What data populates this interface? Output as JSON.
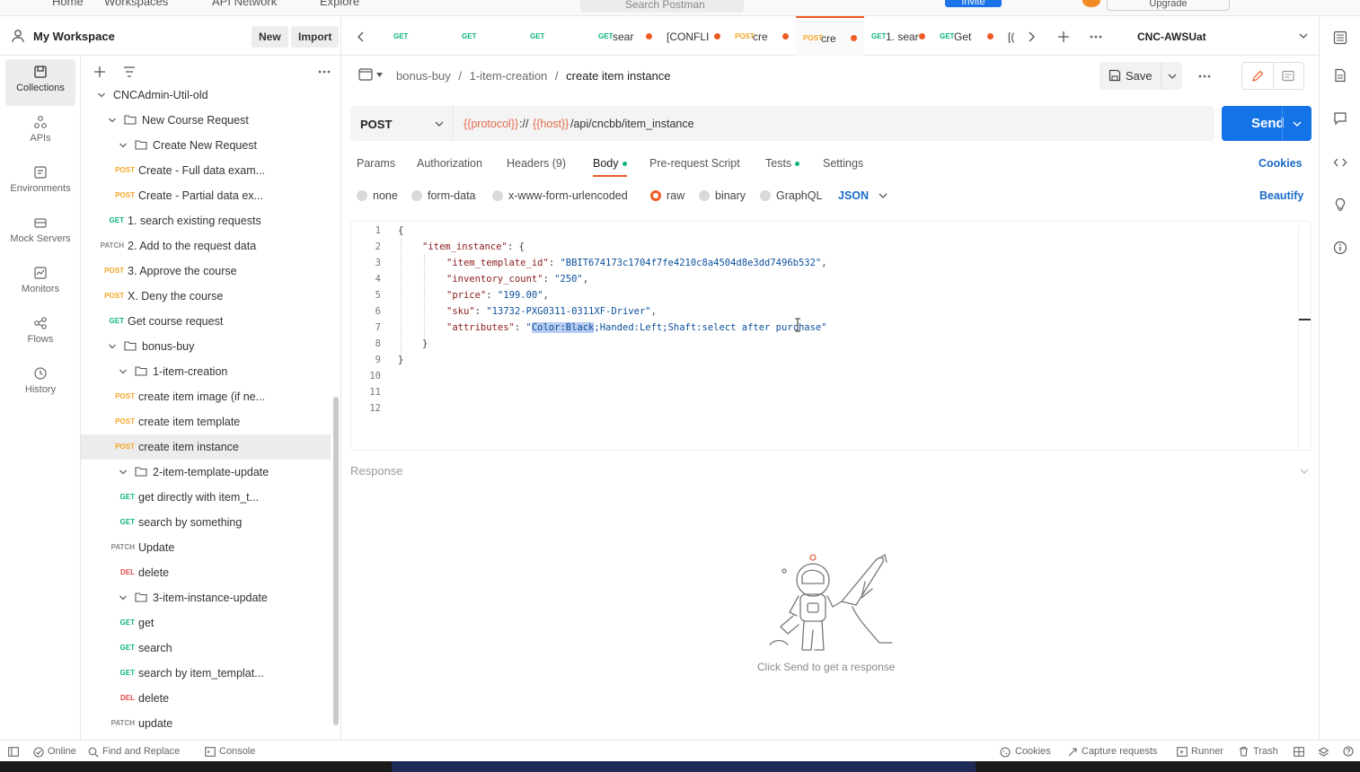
{
  "topbar": {
    "home": "Home",
    "workspaces": "Workspaces",
    "api_network": "API Network",
    "explore": "Explore",
    "search_placeholder": "Search Postman",
    "invite": "Invite",
    "upgrade": "Upgrade"
  },
  "workspace": {
    "title": "My Workspace",
    "new_label": "New",
    "import_label": "Import"
  },
  "rail": [
    {
      "label": "Collections",
      "icon": "collections-icon"
    },
    {
      "label": "APIs",
      "icon": "apis-icon"
    },
    {
      "label": "Environments",
      "icon": "environments-icon"
    },
    {
      "label": "Mock Servers",
      "icon": "mock-servers-icon"
    },
    {
      "label": "Monitors",
      "icon": "monitors-icon"
    },
    {
      "label": "Flows",
      "icon": "flows-icon"
    },
    {
      "label": "History",
      "icon": "history-icon"
    }
  ],
  "tree": [
    {
      "kind": "collection",
      "label": "CNCAdmin-Util-old",
      "method": ""
    },
    {
      "kind": "folder",
      "label": "New Course Request",
      "method": ""
    },
    {
      "kind": "folder",
      "label": "Create New Request",
      "method": ""
    },
    {
      "kind": "request",
      "label": "Create - Full data exam...",
      "method": "POST"
    },
    {
      "kind": "request",
      "label": "Create - Partial data ex...",
      "method": "POST"
    },
    {
      "kind": "request",
      "label": "1. search existing requests",
      "method": "GET"
    },
    {
      "kind": "request",
      "label": "2. Add to the request data",
      "method": "PATCH"
    },
    {
      "kind": "request",
      "label": "3. Approve the course",
      "method": "POST"
    },
    {
      "kind": "request",
      "label": "X. Deny the course",
      "method": "POST"
    },
    {
      "kind": "request",
      "label": "Get course request",
      "method": "GET"
    },
    {
      "kind": "folder",
      "label": "bonus-buy",
      "method": ""
    },
    {
      "kind": "folder",
      "label": "1-item-creation",
      "method": ""
    },
    {
      "kind": "request",
      "label": "create item image (if ne...",
      "method": "POST"
    },
    {
      "kind": "request",
      "label": "create item template",
      "method": "POST"
    },
    {
      "kind": "request",
      "label": "create item instance",
      "method": "POST"
    },
    {
      "kind": "folder",
      "label": "2-item-template-update",
      "method": ""
    },
    {
      "kind": "request",
      "label": "get directly with item_t...",
      "method": "GET"
    },
    {
      "kind": "request",
      "label": "search by something",
      "method": "GET"
    },
    {
      "kind": "request",
      "label": "Update",
      "method": "PATCH"
    },
    {
      "kind": "request",
      "label": "delete",
      "method": "DEL"
    },
    {
      "kind": "folder",
      "label": "3-item-instance-update",
      "method": ""
    },
    {
      "kind": "request",
      "label": "get",
      "method": "GET"
    },
    {
      "kind": "request",
      "label": "search",
      "method": "GET"
    },
    {
      "kind": "request",
      "label": "search by item_templat...",
      "method": "GET"
    },
    {
      "kind": "request",
      "label": "delete",
      "method": "DEL"
    },
    {
      "kind": "request",
      "label": "update",
      "method": "PATCH"
    }
  ],
  "tabs": [
    {
      "method": "GET",
      "title": ""
    },
    {
      "method": "GET",
      "title": ""
    },
    {
      "method": "GET",
      "title": ""
    },
    {
      "method": "GET",
      "title": "sear"
    },
    {
      "method": "",
      "title": "[CONFLI"
    },
    {
      "method": "POST",
      "title": "cre"
    },
    {
      "method": "POST",
      "title": "cre"
    },
    {
      "method": "GET",
      "title": "1. sear"
    },
    {
      "method": "GET",
      "title": "Get"
    },
    {
      "method": "",
      "title": "[("
    }
  ],
  "environment": "CNC-AWSUat",
  "breadcrumb": {
    "collection": "bonus-buy",
    "folder": "1-item-creation",
    "request": "create item instance",
    "sep": "/"
  },
  "save_label": "Save",
  "request": {
    "method": "POST",
    "url_var1": "{{protocol}}",
    "url_mid": "://",
    "url_var2": "{{host}}",
    "url_path": "/api/cncbb/item_instance",
    "send_label": "Send"
  },
  "subtabs": {
    "params": "Params",
    "authorization": "Authorization",
    "headers": "Headers (9)",
    "body": "Body",
    "prerequest": "Pre-request Script",
    "tests": "Tests",
    "settings": "Settings",
    "cookies": "Cookies"
  },
  "body_types": {
    "none": "none",
    "form_data": "form-data",
    "urlencoded": "x-www-form-urlencoded",
    "raw": "raw",
    "binary": "binary",
    "graphql": "GraphQL",
    "lang": "JSON",
    "beautify": "Beautify"
  },
  "code": {
    "l1": "{",
    "l2_key": "\"item_instance\"",
    "l2_rest": ": {",
    "l3_key": "\"item_template_id\"",
    "l3_val": "\"BBIT674173c1704f7fe4210c8a4504d8e3dd7496b532\"",
    "l4_key": "\"inventory_count\"",
    "l4_val": "\"250\"",
    "l5_key": "\"price\"",
    "l5_val": "\"199.00\"",
    "l6_key": "\"sku\"",
    "l6_val": "\"13732-PXG0311-0311XF-Driver\"",
    "l7_key": "\"attributes\"",
    "l7_q": "\"",
    "l7_sel": "Color:Black",
    "l7_rest": ";Handed:Left;Shaft:select after purchase\"",
    "l8": "}",
    "l9": "}",
    "colon": ": ",
    "comma": ","
  },
  "response": {
    "title": "Response",
    "empty": "Click Send to get a response"
  },
  "status": {
    "online": "Online",
    "find_replace": "Find and Replace",
    "console": "Console",
    "cookies": "Cookies",
    "capture": "Capture requests",
    "runner": "Runner",
    "trash": "Trash"
  },
  "colors": {
    "accent": "#EF5B25",
    "send": "#1473E6",
    "post": "#F5A623",
    "get": "#0CB67A",
    "del": "#E44B4B"
  }
}
